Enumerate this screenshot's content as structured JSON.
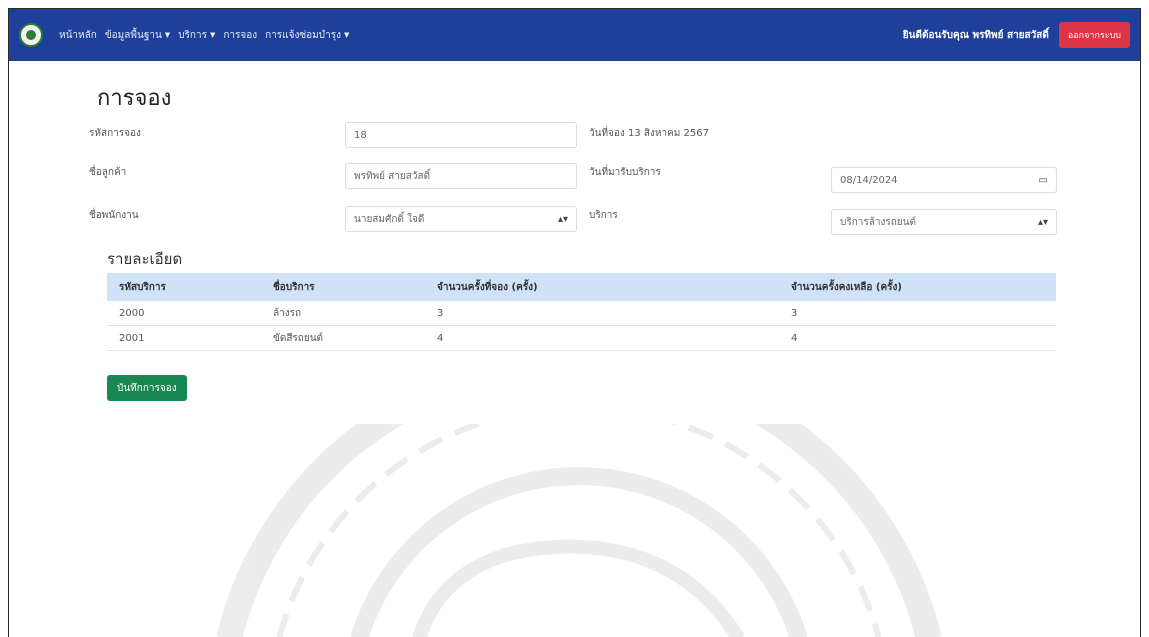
{
  "nav": {
    "links": [
      {
        "label": "หน้าหลัก",
        "caret": false
      },
      {
        "label": "ข้อมูลพื้นฐาน",
        "caret": true
      },
      {
        "label": "บริการ",
        "caret": true
      },
      {
        "label": "การจอง",
        "caret": false
      },
      {
        "label": "การแจ้งซ่อมบำรุง",
        "caret": true
      }
    ],
    "user_label": "ยินดีต้อนรับคุณ พรทิพย์ สายสวัสดิ์",
    "logout_label": "ออกจากระบบ"
  },
  "page": {
    "title": "การจอง"
  },
  "form": {
    "booking_no_label": "รหัสการจอง",
    "booking_no_value": "18",
    "booking_date_text": "วันที่จอง 13 สิงหาคม 2567",
    "customer_label": "ชื่อลูกค้า",
    "customer_value": "พรทิพย์ สายสวัสดิ์",
    "service_date_label": "วันที่มารับบริการ",
    "service_date_value": "08/14/2024",
    "employee_label": "ชื่อพนักงาน",
    "employee_value": "นายสมศักดิ์ ใจดี",
    "service_label": "บริการ",
    "service_value": "บริการล้างรถยนต์"
  },
  "details": {
    "title": "รายละเอียด",
    "columns": [
      "รหัสบริการ",
      "ชื่อบริการ",
      "จำนวนครั้งที่จอง (ครั้ง)",
      "จำนวนครั้งคงเหลือ (ครั้ง)"
    ],
    "rows": [
      [
        "2000",
        "ล้างรถ",
        "3",
        "3"
      ],
      [
        "2001",
        "ขัดสีรถยนต์",
        "4",
        "4"
      ]
    ]
  },
  "save_label": "บันทึกการจอง",
  "colors": {
    "navbar": "#1e3f9a",
    "danger": "#dc3545",
    "success": "#198754",
    "table_header": "#cfe2f7"
  },
  "icons": {
    "logo": "university-seal-icon",
    "calendar": "calendar-icon",
    "select": "chevron-down-icon"
  }
}
